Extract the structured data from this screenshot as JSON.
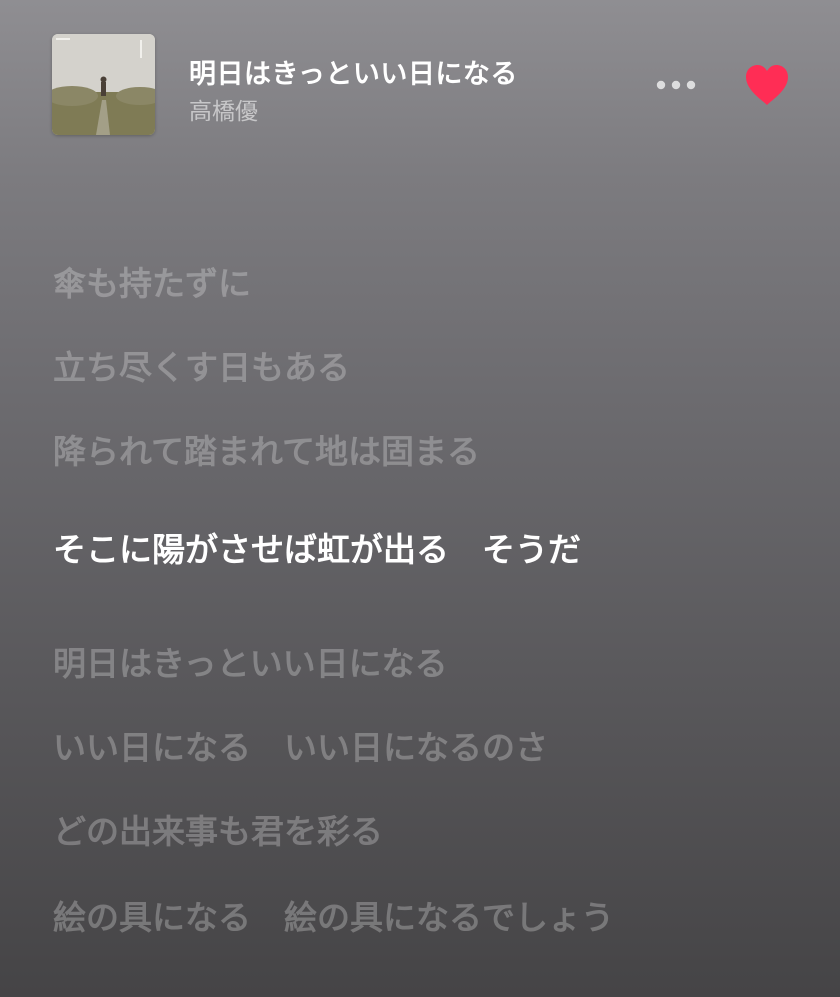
{
  "now_playing": {
    "title": "明日はきっといい日になる",
    "artist": "高橋優",
    "loved": true,
    "accent_color": "#ff2d55"
  },
  "icons": {
    "more": "ellipsis-icon",
    "love": "heart-filled-icon"
  },
  "lyrics": {
    "active_index": 3,
    "lines": [
      "傘も持たずに",
      "立ち尽くす日もある",
      "降られて踏まれて地は固まる",
      "そこに陽がさせば虹が出る　そうだ",
      "明日はきっといい日になる",
      "いい日になる　いい日になるのさ",
      "どの出来事も君を彩る",
      "絵の具になる　絵の具になるでしょう"
    ]
  }
}
